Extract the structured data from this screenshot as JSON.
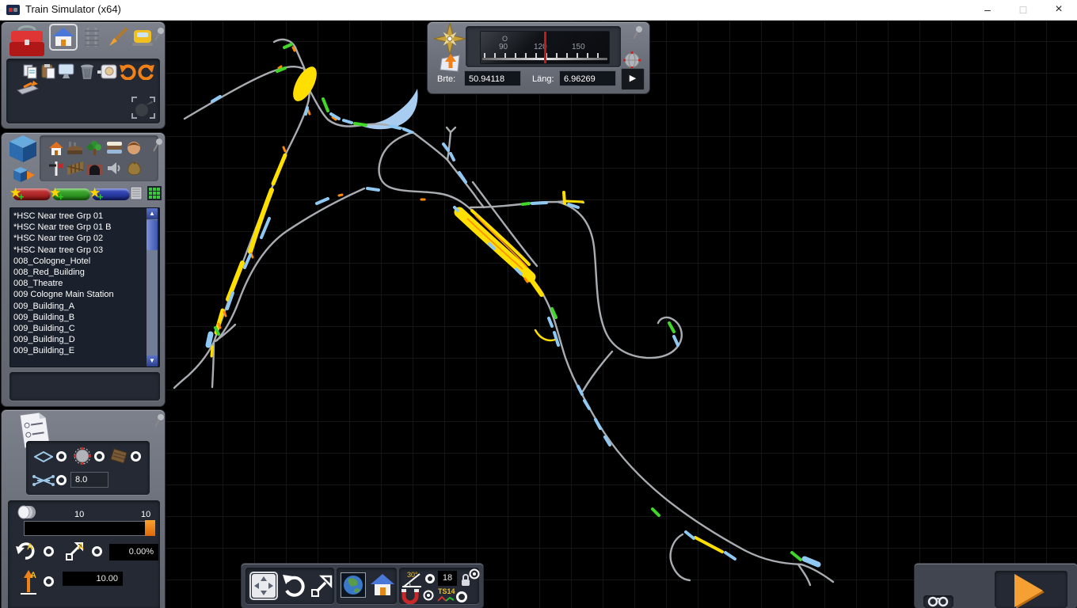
{
  "window": {
    "title": "Train Simulator (x64)",
    "minimize": "–",
    "maximize": "□",
    "close": "×"
  },
  "compass": {
    "east_label": "O",
    "tick_90": "90",
    "tick_120": "120",
    "tick_150": "150",
    "lat_label": "Brte:",
    "lat_value": "50.94118",
    "lon_label": "Läng:",
    "lon_value": "6.96269"
  },
  "assets": {
    "items": [
      "*HSC Near tree Grp 01",
      "*HSC Near tree Grp 01 B",
      "*HSC Near tree Grp 02",
      "*HSC Near tree Grp 03",
      "008_Cologne_Hotel",
      "008_Red_Building",
      "008_Theatre",
      "009 Cologne Main Station",
      "009_Building_A",
      "009_Building_B",
      "009_Building_C",
      "009_Building_D",
      "009_Building_E"
    ]
  },
  "properties": {
    "spacing_value": "8.0",
    "slider_value_mid": "10",
    "slider_value_max": "10",
    "rotation_value": "0.00%",
    "height_value": "10.00"
  },
  "map_toolbar": {
    "angle_value": "30°",
    "grid_value": "18",
    "ts_label": "TS14"
  },
  "icons": {
    "star": "★",
    "plus": "+",
    "scroll_up": "▲",
    "scroll_down": "▼",
    "play": "▶"
  },
  "colors": {
    "accent_orange": "#f08018",
    "track_gray": "#a9adb2",
    "selection_yellow": "#ffdf00",
    "marker_blue": "#8fc8f2",
    "marker_green": "#42d62a",
    "river_blue": "#a8cdf0"
  }
}
